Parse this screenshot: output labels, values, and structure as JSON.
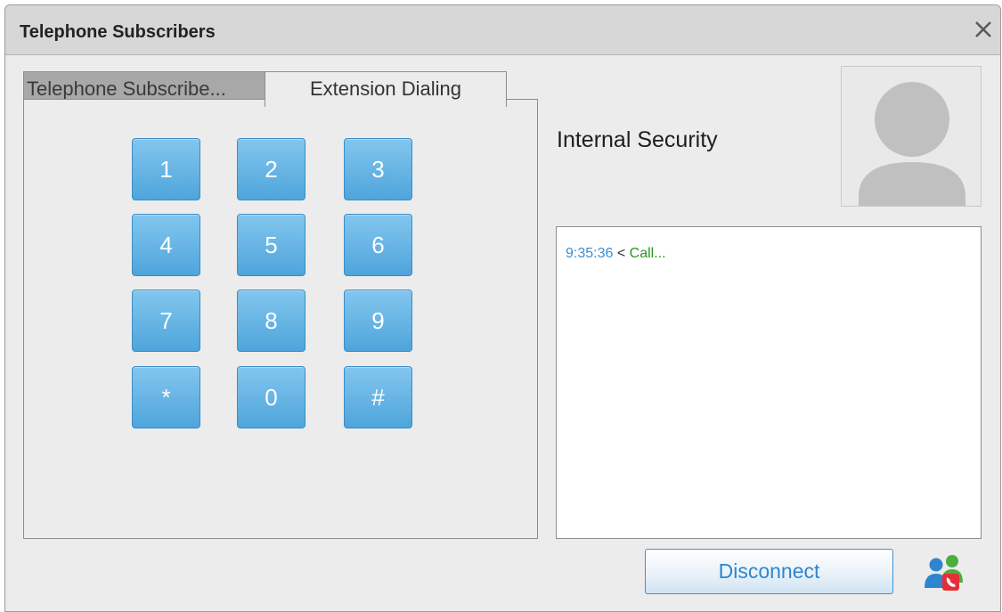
{
  "window": {
    "title": "Telephone Subscribers"
  },
  "tabs": [
    {
      "label": "Telephone Subscribe...",
      "active": false
    },
    {
      "label": "Extension Dialing",
      "active": true
    }
  ],
  "keypad": {
    "keys": [
      "1",
      "2",
      "3",
      "4",
      "5",
      "6",
      "7",
      "8",
      "9",
      "*",
      "0",
      "#"
    ]
  },
  "contact": {
    "name": "Internal Security",
    "avatar_icon": "user-silhouette-icon"
  },
  "log": {
    "entries": [
      {
        "time": "9:35:36",
        "separator": "<",
        "message": "Call..."
      }
    ]
  },
  "footer": {
    "disconnect_label": "Disconnect",
    "call_icon": "users-call-icon"
  },
  "colors": {
    "key_fill": "#5aaee2",
    "log_time": "#3a8fd4",
    "log_message": "#27951c",
    "button_text": "#2e86cf"
  }
}
